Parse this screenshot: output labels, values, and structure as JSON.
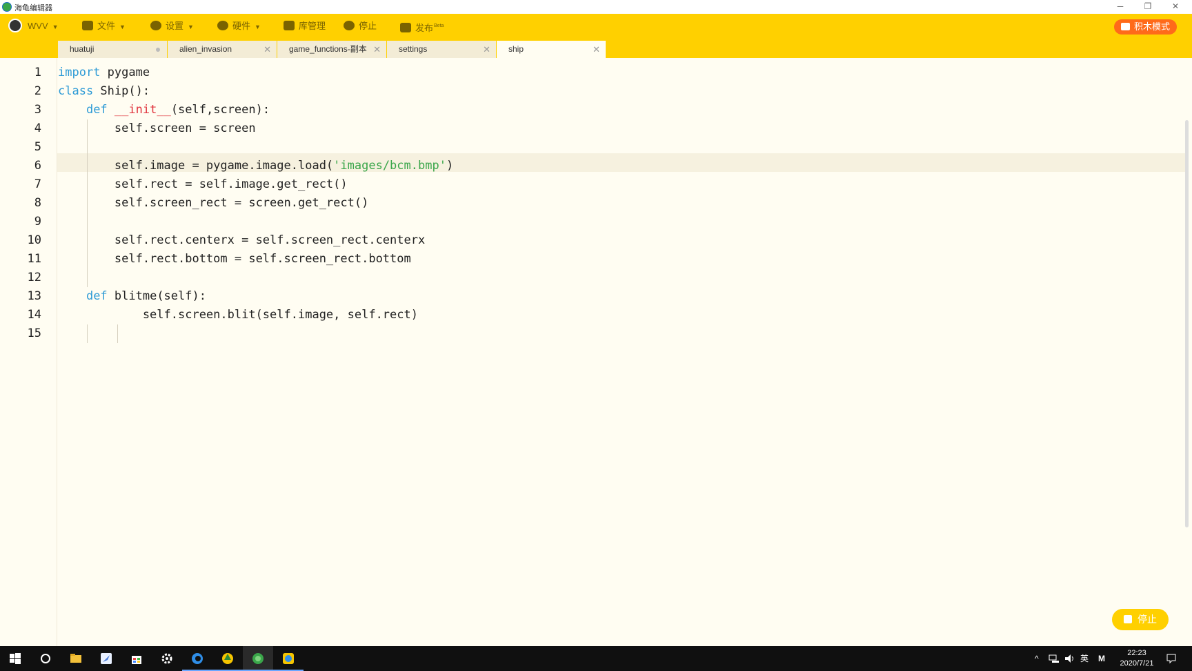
{
  "window": {
    "title": "海龟编辑器",
    "controls": [
      "─",
      "❐",
      "✕"
    ]
  },
  "toolbar": {
    "user_label": "WVV",
    "file_label": "文件",
    "settings_label": "设置",
    "hardware_label": "硬件",
    "library_label": "库管理",
    "stop_label": "停止",
    "publish_label": "发布",
    "publish_badge": "Beta",
    "block_mode_label": "积木模式"
  },
  "tabs": [
    {
      "label": "huatuji",
      "modified": true
    },
    {
      "label": "alien_invasion",
      "modified": false
    },
    {
      "label": "game_functions-副本",
      "modified": false
    },
    {
      "label": "settings",
      "modified": false
    },
    {
      "label": "ship",
      "modified": false,
      "active": true
    }
  ],
  "editor": {
    "line_numbers": [
      "1",
      "2",
      "3",
      "4",
      "5",
      "6",
      "7",
      "8",
      "9",
      "10",
      "11",
      "12",
      "13",
      "14",
      "15"
    ],
    "highlighted_line": 6,
    "lines": [
      "import pygame",
      "class Ship():",
      "    def __init__(self,screen):",
      "        self.screen = screen",
      "",
      "        self.image = pygame.image.load('images/bcm.bmp')",
      "        self.rect = self.image.get_rect()",
      "        self.screen_rect = screen.get_rect()",
      "",
      "        self.rect.centerx = self.screen_rect.centerx",
      "        self.rect.bottom = self.screen_rect.bottom",
      "",
      "    def blitme(self):",
      "            self.screen.blit(self.image, self.rect)",
      ""
    ]
  },
  "floating_stop": {
    "label": "停止"
  },
  "taskbar": {
    "apps": [
      "windows-start-icon",
      "cortana-icon",
      "file-explorer-icon",
      "feather-app-icon",
      "store-icon",
      "settings-icon",
      "edge-icon",
      "kite-app-icon",
      "turtle-editor-icon",
      "qq-icon"
    ],
    "tray": {
      "ime": "英",
      "ime_mode": "M"
    },
    "time": "22:23",
    "date": "2020/7/21"
  },
  "colors": {
    "toolbar": "#ffd000",
    "keyword": "#2e9bd6",
    "function": "#e0333d",
    "string": "#3aa64a",
    "block_mode": "#ff6a1a"
  }
}
